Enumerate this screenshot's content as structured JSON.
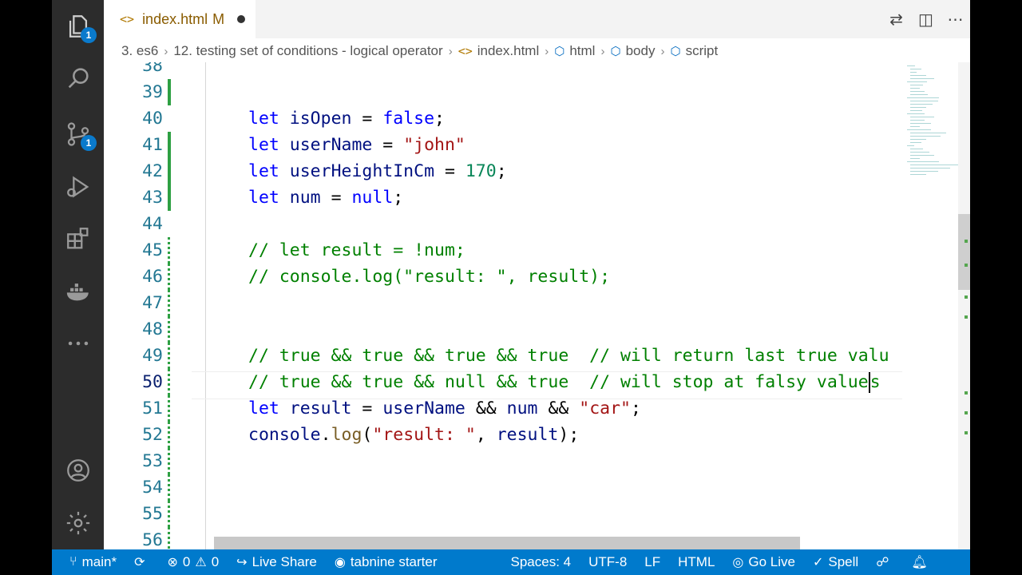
{
  "tab": {
    "file": "index.html",
    "badge": "M"
  },
  "breadcrumb": [
    "3. es6",
    "12. testing set of conditions - logical operator",
    "index.html",
    "html",
    "body",
    "script"
  ],
  "activity": {
    "explorer_badge": "1",
    "scm_badge": "1"
  },
  "code_lines": [
    {
      "n": "38",
      "code": []
    },
    {
      "n": "39",
      "code": []
    },
    {
      "n": "40",
      "code": [
        [
          "kw",
          "let"
        ],
        [
          "op",
          " "
        ],
        [
          "var",
          "isOpen"
        ],
        [
          "op",
          " = "
        ],
        [
          "kw",
          "false"
        ],
        [
          "op",
          ";"
        ]
      ]
    },
    {
      "n": "41",
      "code": [
        [
          "kw",
          "let"
        ],
        [
          "op",
          " "
        ],
        [
          "var",
          "userName"
        ],
        [
          "op",
          " = "
        ],
        [
          "str",
          "\"john\""
        ]
      ]
    },
    {
      "n": "42",
      "code": [
        [
          "kw",
          "let"
        ],
        [
          "op",
          " "
        ],
        [
          "var",
          "userHeightInCm"
        ],
        [
          "op",
          " = "
        ],
        [
          "num",
          "170"
        ],
        [
          "op",
          ";"
        ]
      ]
    },
    {
      "n": "43",
      "code": [
        [
          "kw",
          "let"
        ],
        [
          "op",
          " "
        ],
        [
          "var",
          "num"
        ],
        [
          "op",
          " = "
        ],
        [
          "kw",
          "null"
        ],
        [
          "op",
          ";"
        ]
      ]
    },
    {
      "n": "44",
      "code": []
    },
    {
      "n": "45",
      "code": [
        [
          "cm",
          "// let result = !num;"
        ]
      ]
    },
    {
      "n": "46",
      "code": [
        [
          "cm",
          "// console.log(\"result: \", result);"
        ]
      ]
    },
    {
      "n": "47",
      "code": []
    },
    {
      "n": "48",
      "code": []
    },
    {
      "n": "49",
      "code": [
        [
          "cm",
          "// true && true && true && true  // will return last true valu"
        ]
      ]
    },
    {
      "n": "50",
      "code": [
        [
          "cm",
          "// true && true && null && true  // will stop at falsy values"
        ]
      ]
    },
    {
      "n": "51",
      "code": [
        [
          "kw",
          "let"
        ],
        [
          "op",
          " "
        ],
        [
          "var",
          "result"
        ],
        [
          "op",
          " = "
        ],
        [
          "var",
          "userName"
        ],
        [
          "op",
          " && "
        ],
        [
          "var",
          "num"
        ],
        [
          "op",
          " && "
        ],
        [
          "str",
          "\"car\""
        ],
        [
          "op",
          ";"
        ]
      ]
    },
    {
      "n": "52",
      "code": [
        [
          "var",
          "console"
        ],
        [
          "op",
          "."
        ],
        [
          "fn",
          "log"
        ],
        [
          "op",
          "("
        ],
        [
          "str",
          "\"result: \""
        ],
        [
          "op",
          ", "
        ],
        [
          "var",
          "result"
        ],
        [
          "op",
          ");"
        ]
      ]
    },
    {
      "n": "53",
      "code": []
    },
    {
      "n": "54",
      "code": []
    },
    {
      "n": "55",
      "code": []
    },
    {
      "n": "56",
      "code": []
    }
  ],
  "status": {
    "branch": "main*",
    "errors": "0",
    "warnings": "0",
    "live_share": "Live Share",
    "tabnine": "tabnine starter",
    "spaces": "Spaces: 4",
    "encoding": "UTF-8",
    "eol": "LF",
    "language": "HTML",
    "go_live": "Go Live",
    "spell": "Spell"
  }
}
